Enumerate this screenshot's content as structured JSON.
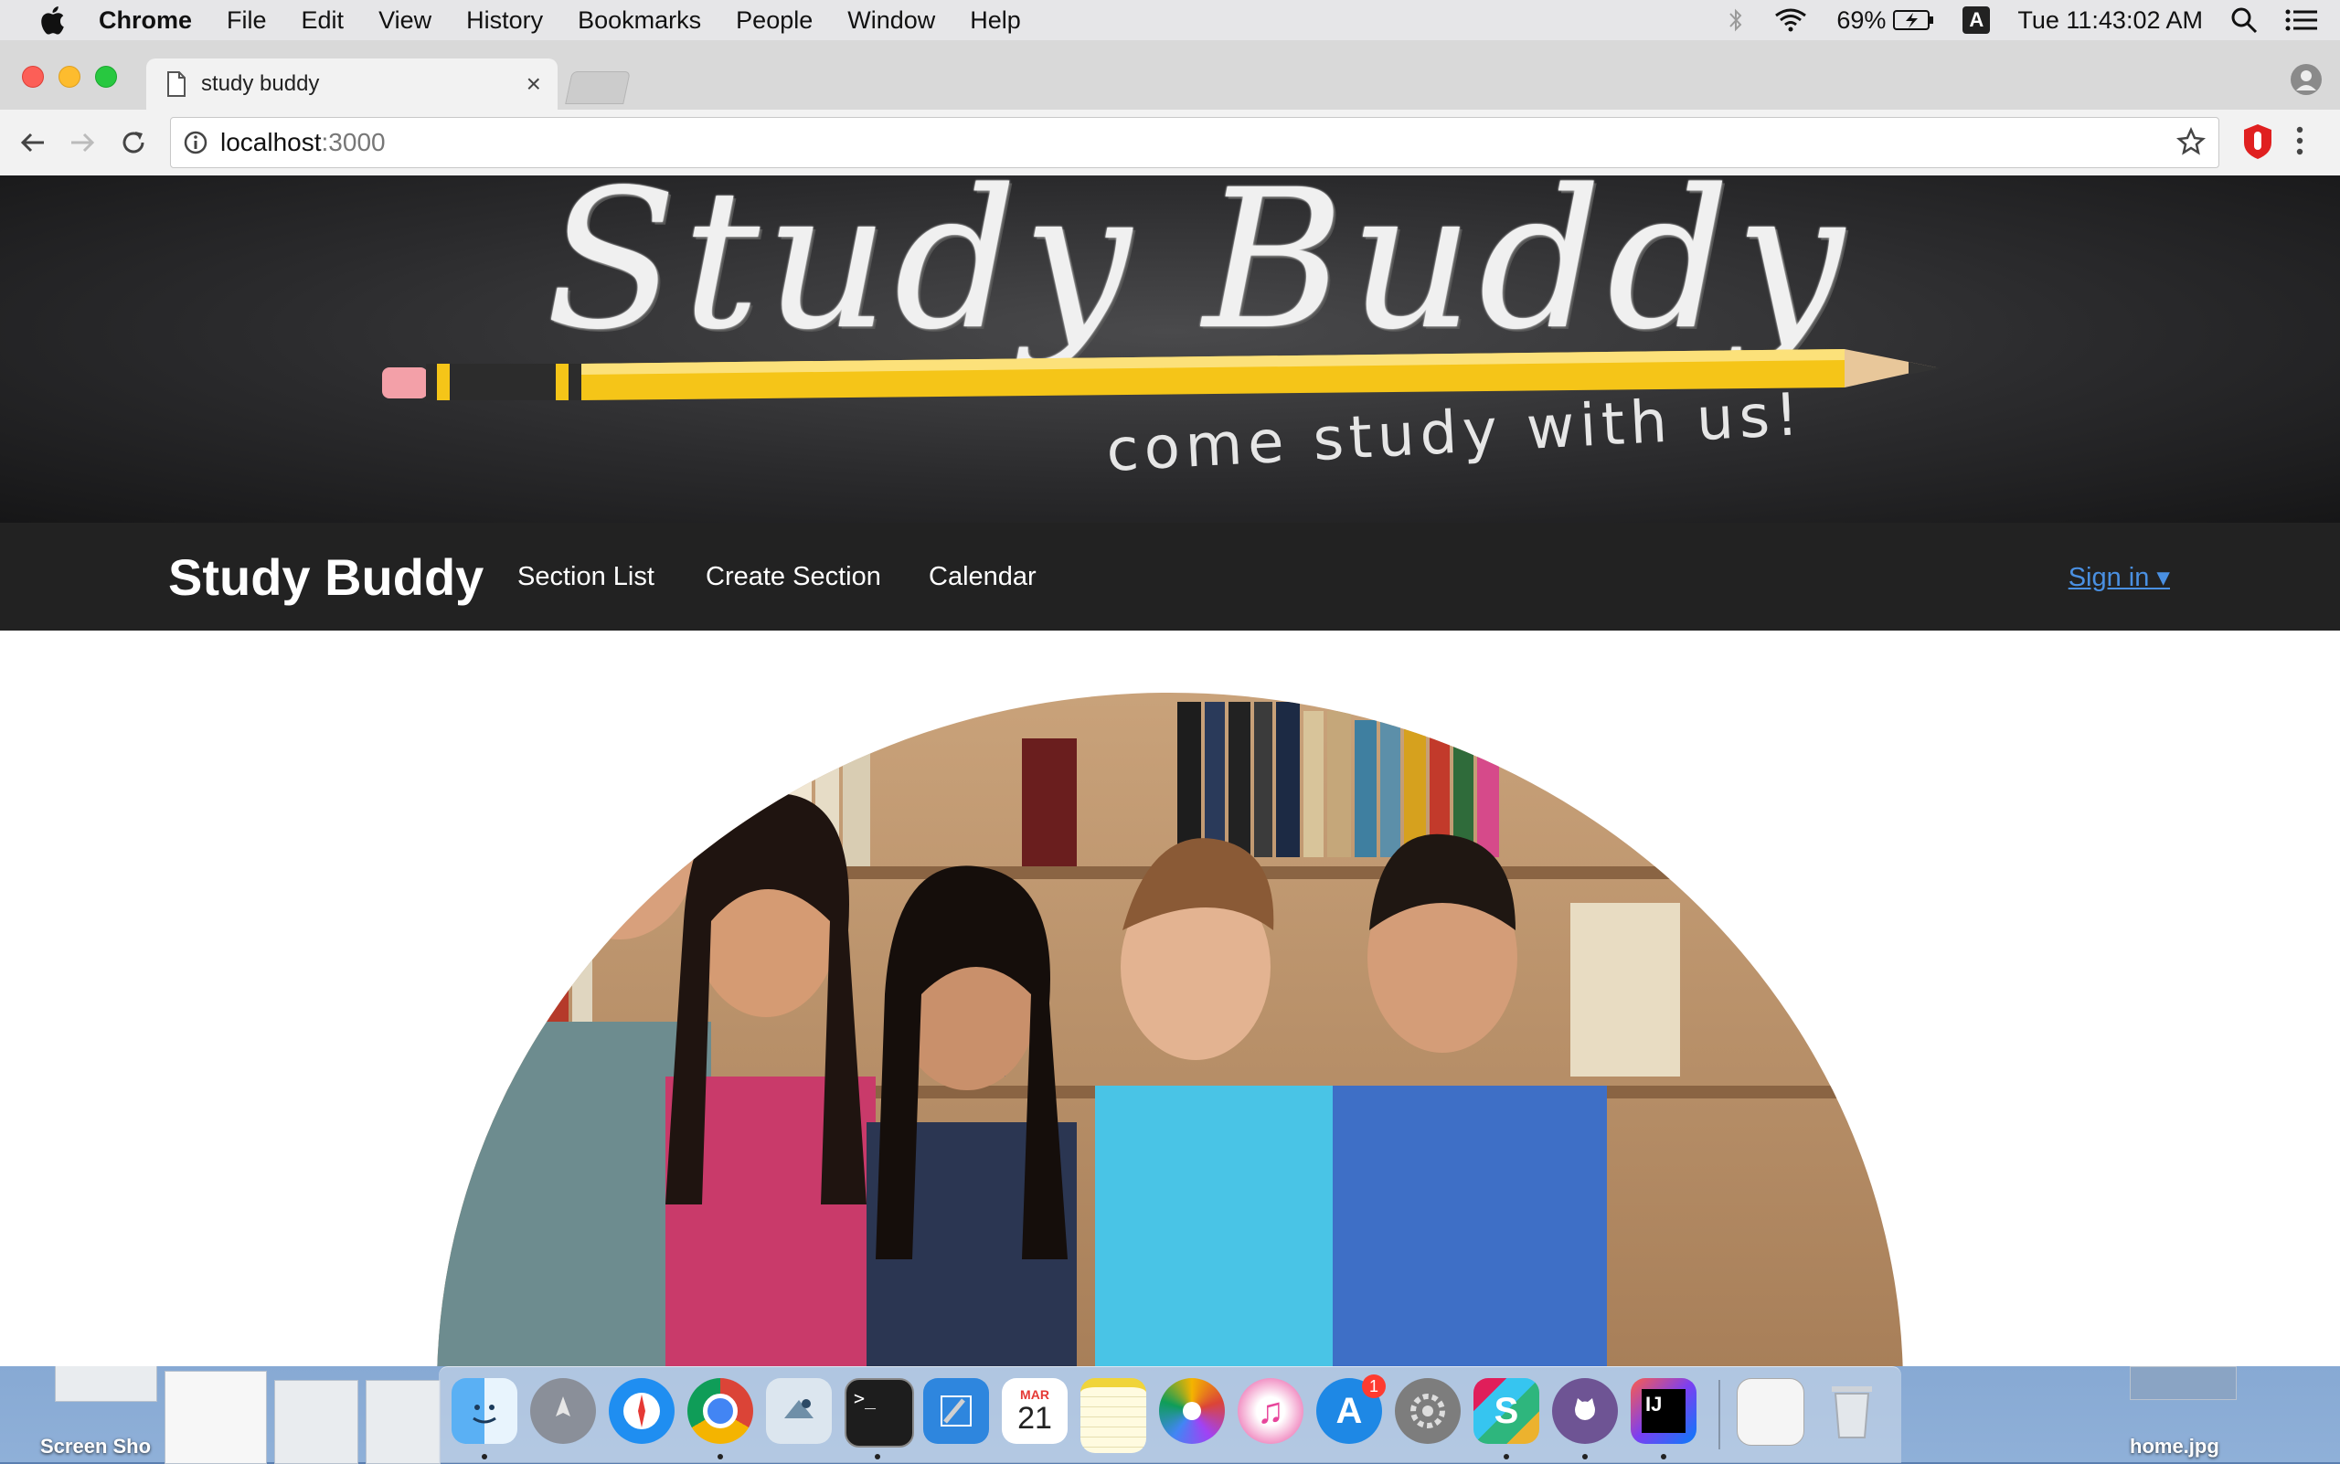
{
  "menubar": {
    "app": "Chrome",
    "items": [
      "File",
      "Edit",
      "View",
      "History",
      "Bookmarks",
      "People",
      "Window",
      "Help"
    ],
    "battery": "69%",
    "input_source": "A",
    "clock": "Tue 11:43:02 AM"
  },
  "browser": {
    "tab_title": "study buddy",
    "url_host": "localhost",
    "url_port": ":3000"
  },
  "page": {
    "hero_title": "Study Buddy",
    "hero_tagline": "come study with us!",
    "brand": "Study Buddy",
    "nav": [
      "Section List",
      "Create Section",
      "Calendar"
    ],
    "signin": "Sign in ▾"
  },
  "dock": {
    "apps": [
      "finder-icon",
      "launchpad-icon",
      "safari-icon",
      "chrome-icon",
      "mail-icon",
      "terminal-icon",
      "xcode-icon",
      "calendar-icon",
      "notes-icon",
      "photos-icon",
      "itunes-icon",
      "app-store-icon",
      "system-preferences-icon",
      "slack-icon",
      "github-icon",
      "intellij-icon",
      "preview-icon",
      "trash-icon"
    ],
    "calendar_month": "MAR",
    "calendar_day": "21",
    "app_store_badge": "1",
    "terminal_prompt": ">_",
    "intellij_label": "IJ",
    "slack_label": "S"
  },
  "desktop": {
    "left_label": "Screen Sho",
    "right_label": "home.jpg"
  },
  "colors": {
    "nav_bg": "#222222",
    "link_blue": "#4a90e2",
    "pencil_yellow": "#f5c518"
  }
}
